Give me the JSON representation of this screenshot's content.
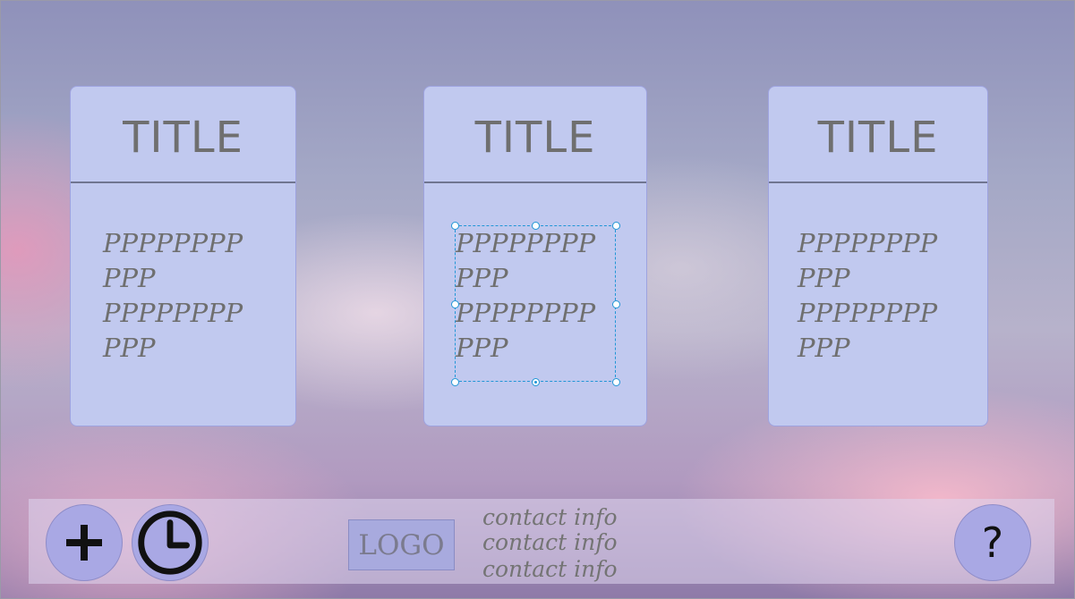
{
  "cards": [
    {
      "title": "TITLE",
      "body": "PPPPPPPP\nPPP\nPPPPPPPP\nPPP"
    },
    {
      "title": "TITLE",
      "body": "PPPPPPPP\nPPP\nPPPPPPPP\nPPP"
    },
    {
      "title": "TITLE",
      "body": "PPPPPPPP\nPPP\nPPPPPPPP\nPPP"
    }
  ],
  "footer": {
    "add_icon": "plus-icon",
    "history_icon": "clock-icon",
    "logo_text": "LOGO",
    "contact_lines": [
      "contact info",
      "contact info",
      "contact info"
    ],
    "help_label": "?"
  },
  "colors": {
    "card_fill": "#c1c9ef",
    "button_fill": "#a9a8e4",
    "selection_accent": "#2196d6"
  }
}
